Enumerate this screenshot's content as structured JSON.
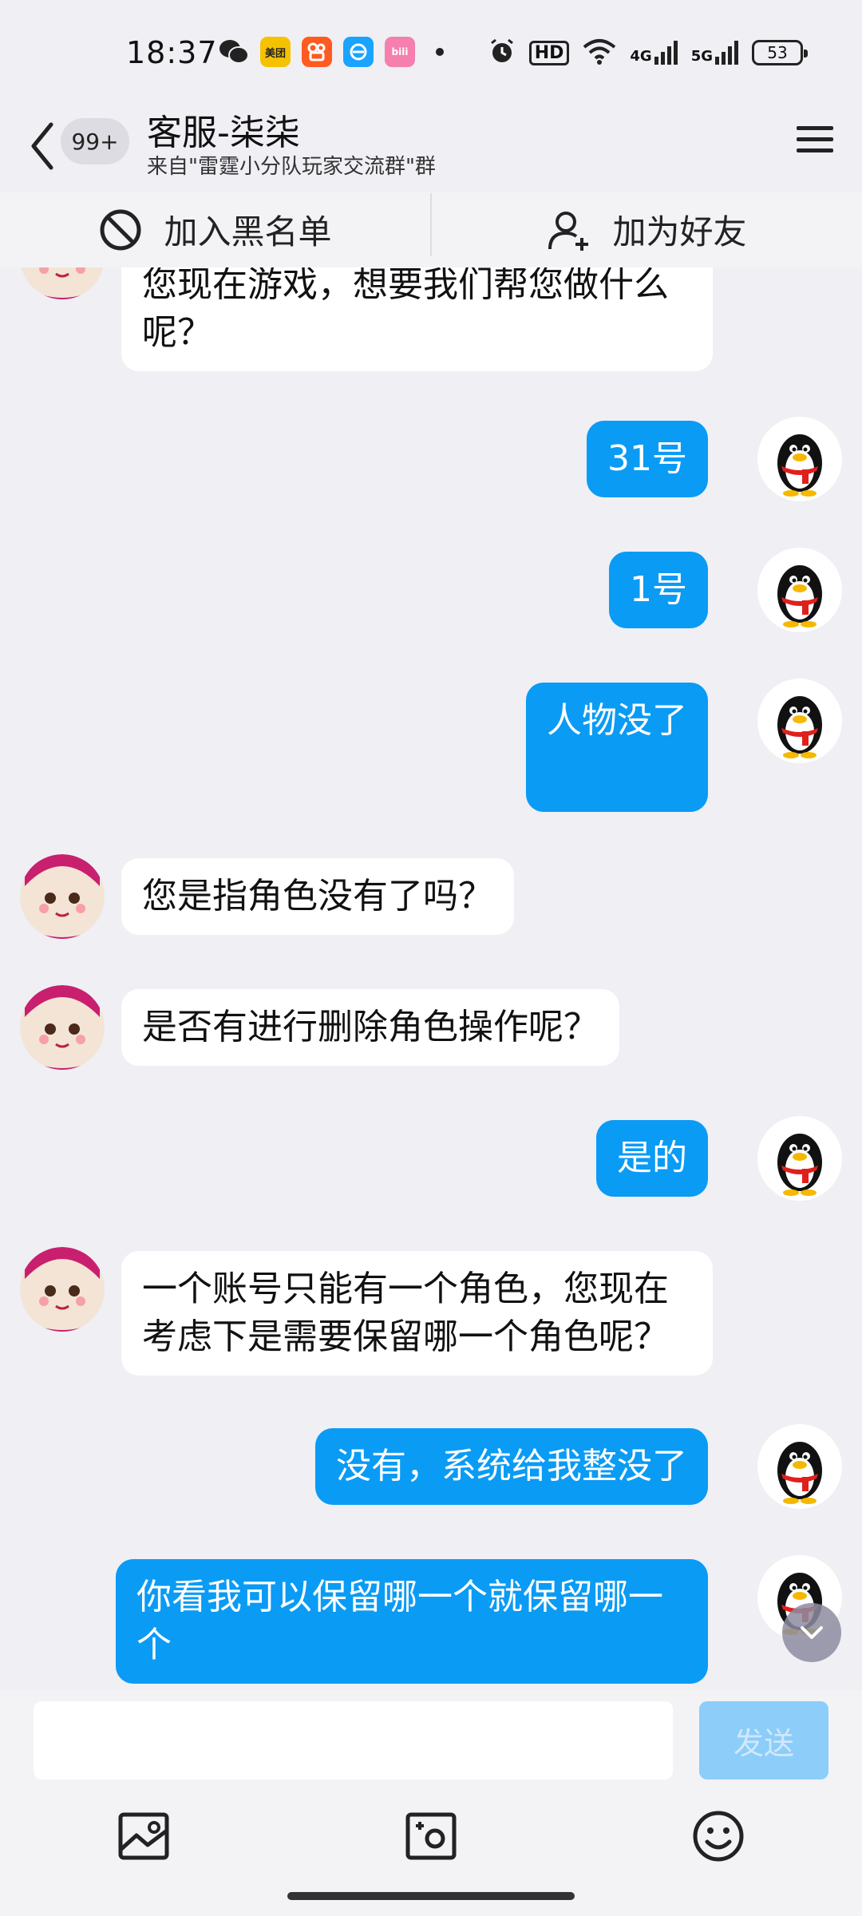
{
  "status_bar": {
    "time": "18:37",
    "apps": [
      {
        "name": "wechat-icon",
        "color": "#222222",
        "label": ""
      },
      {
        "name": "meituan-icon",
        "color": "#f5c200",
        "label": "美团"
      },
      {
        "name": "kuaishou-icon",
        "color": "#ff5a1f",
        "label": ""
      },
      {
        "name": "browser-icon",
        "color": "#1aa3ff",
        "label": ""
      },
      {
        "name": "bilibili-icon",
        "color": "#f57fae",
        "label": "bili"
      }
    ],
    "hd_label": "HD",
    "net1": "4G",
    "net2": "5G",
    "battery": "53"
  },
  "header": {
    "unread": "99+",
    "title": "客服-柒柒",
    "subtitle": "来自\"雷霆小分队玩家交流群\"群"
  },
  "actions": {
    "blacklist": "加入黑名单",
    "add_friend": "加为好友"
  },
  "messages": [
    {
      "side": "in",
      "text": "您现在游戏，想要我们帮您做什么呢？"
    },
    {
      "side": "out",
      "text": "31号"
    },
    {
      "side": "out",
      "text": "1号"
    },
    {
      "side": "out",
      "text": "人物没了"
    },
    {
      "side": "in",
      "text": "您是指角色没有了吗？"
    },
    {
      "side": "in",
      "text": "是否有进行删除角色操作呢？"
    },
    {
      "side": "out",
      "text": "是的"
    },
    {
      "side": "in",
      "text": "一个账号只能有一个角色，您现在考虑下是需要保留哪一个角色呢？"
    },
    {
      "side": "out",
      "text": "没有，系统给我整没了"
    },
    {
      "side": "out",
      "text": "你看我可以保留哪一个就保留哪一个"
    }
  ],
  "input": {
    "value": "",
    "send_label": "发送"
  },
  "colors": {
    "accent": "#0a9bf5",
    "send_disabled": "#8ccdf9",
    "background": "#efeff4"
  }
}
